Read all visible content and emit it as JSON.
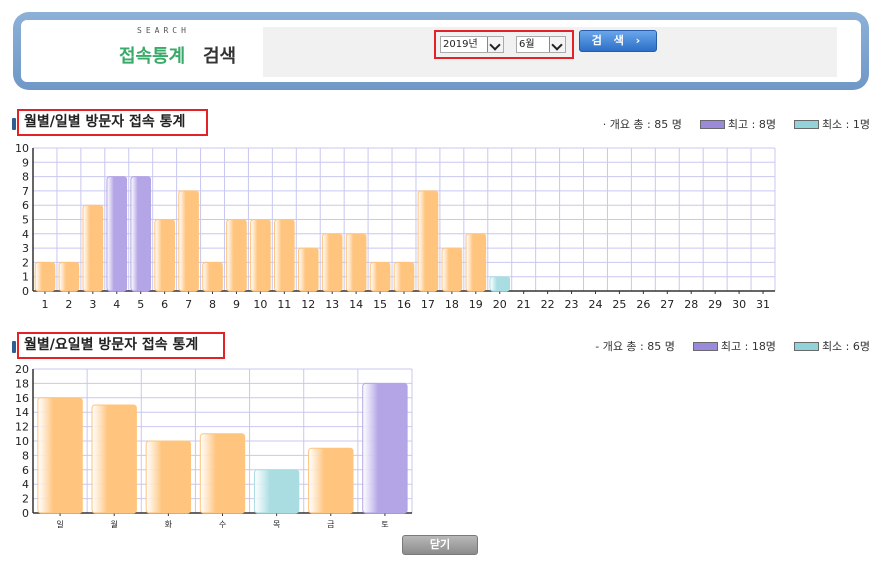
{
  "search": {
    "caption": "SEARCH",
    "title_green": "접속통계",
    "title_dark": "검색",
    "year_value": "2019년",
    "month_value": "6월",
    "button_label": "검 색 ›"
  },
  "daily": {
    "title": "월별/일별 방문자 접속 통계",
    "total": "· 개요 총 : 85 명",
    "max_label": "최고 : 8명",
    "min_label": "최소 : 1명"
  },
  "weekday": {
    "title": "월별/요일별 방문자 접속 통계",
    "total": "- 개요 총 : 85 명",
    "max_label": "최고 : 18명",
    "min_label": "최소 : 6명"
  },
  "close_label": "닫기",
  "colors": {
    "normal": "#ffc47e",
    "max": "#b3a5e6",
    "min": "#a9dde2",
    "grid": "#c8c8f0",
    "highlight_border": "#e32228"
  },
  "chart_data": [
    {
      "type": "bar",
      "title": "월별/일별 방문자 접속 통계",
      "categories": [
        "1",
        "2",
        "3",
        "4",
        "5",
        "6",
        "7",
        "8",
        "9",
        "10",
        "11",
        "12",
        "13",
        "14",
        "15",
        "16",
        "17",
        "18",
        "19",
        "20",
        "21",
        "22",
        "23",
        "24",
        "25",
        "26",
        "27",
        "28",
        "29",
        "30",
        "31"
      ],
      "values": [
        2,
        2,
        6,
        8,
        8,
        5,
        7,
        2,
        5,
        5,
        5,
        3,
        4,
        4,
        2,
        2,
        7,
        3,
        4,
        1,
        0,
        0,
        0,
        0,
        0,
        0,
        0,
        0,
        0,
        0,
        0
      ],
      "ylim": [
        0,
        10
      ],
      "yticks": [
        "0",
        "1",
        "2",
        "3",
        "4",
        "5",
        "6",
        "7",
        "8",
        "9",
        "10"
      ],
      "grid": true
    },
    {
      "type": "bar",
      "title": "월별/요일별 방문자 접속 통계",
      "categories": [
        "일",
        "월",
        "화",
        "수",
        "목",
        "금",
        "토"
      ],
      "values": [
        16,
        15,
        10,
        11,
        6,
        9,
        18
      ],
      "ylim": [
        0,
        20
      ],
      "yticks": [
        "0",
        "2",
        "4",
        "6",
        "8",
        "10",
        "12",
        "14",
        "16",
        "18",
        "20"
      ],
      "grid": true
    }
  ]
}
